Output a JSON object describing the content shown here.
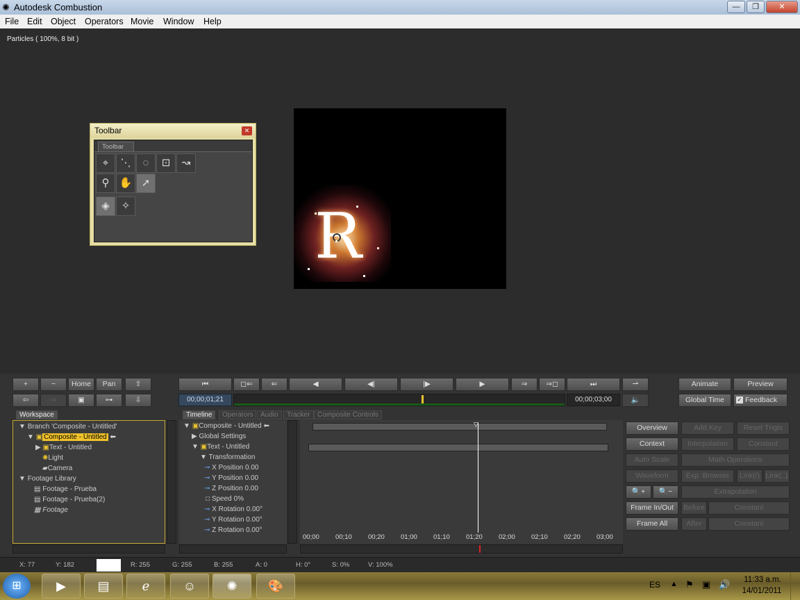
{
  "window": {
    "title": "Autodesk Combustion",
    "minimize": "—",
    "restore": "❐",
    "close": "✕"
  },
  "menu": [
    "File",
    "Edit",
    "Object",
    "Operators",
    "Movie",
    "Window",
    "Help"
  ],
  "viewer": {
    "label": "Particles ( 100%, 8 bit )",
    "letter": "R"
  },
  "toolbar_window": {
    "title": "Toolbar",
    "tab": "Toolbar"
  },
  "nav_buttons": {
    "plus": "+",
    "minus": "−",
    "home": "Home",
    "pan": "Pan"
  },
  "transport": {
    "current_time": "00;00;01;21",
    "end_time": "00;00;03;00"
  },
  "right_buttons": {
    "animate": "Animate",
    "preview": "Preview",
    "global_time": "Global Time",
    "feedback": "Feedback"
  },
  "workspace": {
    "tab": "Workspace",
    "items": [
      "Branch 'Composite - Untitled'",
      "Composite - Untitled",
      "Text - Untitled",
      "Light",
      "Camera",
      "Footage Library",
      "Footage - Prueba",
      "Footage - Prueba(2)",
      "Footage"
    ]
  },
  "timeline": {
    "tabs": [
      "Timeline",
      "Operators",
      "Audio",
      "Tracker",
      "Composite Controls"
    ],
    "rows": [
      "Composite - Untitled",
      "Global Settings",
      "Text - Untitled",
      "Transformation",
      "X Position  0.00",
      "Y Position  0.00",
      "Z Position  0.00",
      "Speed  0%",
      "X Rotation  0.00°",
      "Y Rotation  0.00°",
      "Z Rotation  0.00°"
    ],
    "ticks": [
      "00;00",
      "00;10",
      "00;20",
      "01;00",
      "01;10",
      "01;20",
      "02;00",
      "02;10",
      "02;20",
      "03;00"
    ]
  },
  "side_controls": {
    "overview": "Overview",
    "add_key": "Add Key",
    "reset_tngts": "Reset Tngts",
    "context": "Context",
    "interpolation": "Interpolation",
    "constant1": "Constant",
    "auto_scale": "Auto Scale",
    "math_ops": "Math Operations",
    "waveform": "Waveform",
    "exp_browser": "Exp. Browser",
    "link1": "Link(/)",
    "link2": "Link(..)",
    "extrapolation": "Extrapolation",
    "frame_inout": "Frame In/Out",
    "before": "Before",
    "constant2": "Constant",
    "frame_all": "Frame All",
    "after": "After",
    "constant3": "Constant"
  },
  "status": {
    "x": "X:   77",
    "y": "Y:  182",
    "r": "R: 255",
    "g": "G: 255",
    "b": "B: 255",
    "a": "A: 0",
    "h": "H: 0°",
    "s": "S: 0%",
    "v": "V: 100%"
  },
  "taskbar": {
    "lang": "ES",
    "time": "11:33 a.m.",
    "date": "14/01/2011"
  }
}
